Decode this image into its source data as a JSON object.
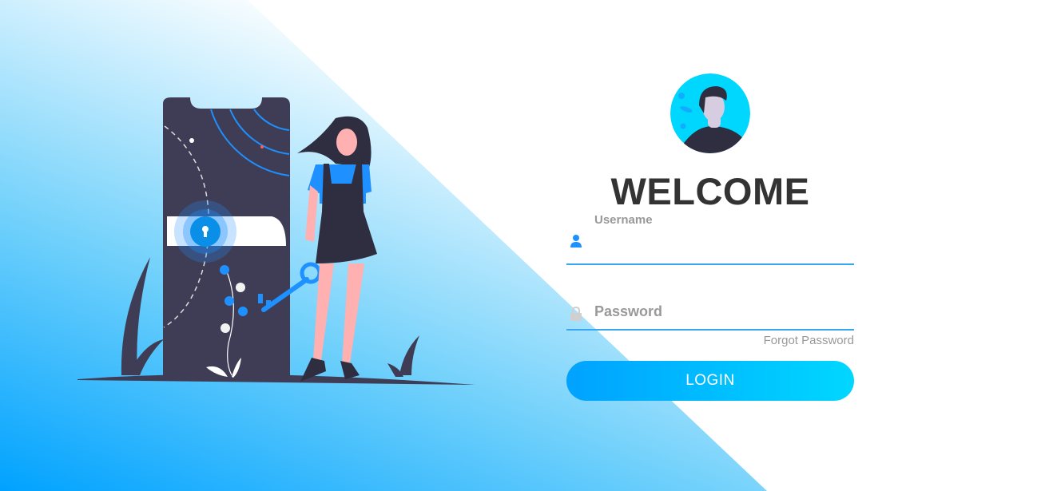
{
  "colors": {
    "accent": "#38a6f0",
    "gradient_start": "#00a2ff",
    "gradient_end": "#00d7ff",
    "heading": "#333333",
    "muted": "#999999",
    "phone": "#3f3d56"
  },
  "avatar": {
    "icon": "user-avatar"
  },
  "heading": "WELCOME",
  "username": {
    "label": "Username",
    "value": "",
    "icon": "user-icon"
  },
  "password": {
    "placeholder": "Password",
    "value": "",
    "icon": "lock-icon"
  },
  "forgot_password": "Forgot Password",
  "login_button": "LOGIN"
}
